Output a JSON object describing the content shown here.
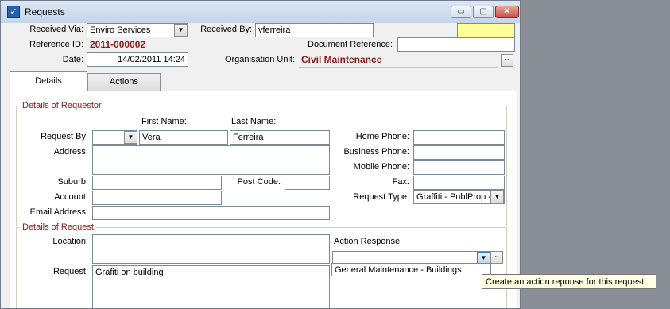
{
  "window": {
    "title": "Requests",
    "minimize": "▭",
    "maximize": "▢",
    "close": "✕"
  },
  "header": {
    "received_via_label": "Received Via:",
    "received_via_value": "Enviro Services",
    "received_by_label": "Received By:",
    "received_by_value": "vferreira",
    "reference_id_label": "Reference ID:",
    "reference_id_value": "2011-000002",
    "document_reference_label": "Document Reference:",
    "document_reference_value": "",
    "date_label": "Date:",
    "date_value": "14/02/2011 14:24",
    "org_unit_label": "Organisation Unit:",
    "org_unit_value": "Civil Maintenance"
  },
  "tabs": [
    {
      "label": "Details"
    },
    {
      "label": "Actions"
    }
  ],
  "requestor": {
    "group_title": "Details of Requestor",
    "first_name_label": "First Name:",
    "last_name_label": "Last Name:",
    "request_by_label": "Request By:",
    "request_by_value": "",
    "first_name_value": "Vera",
    "last_name_value": "Ferreira",
    "address_label": "Address:",
    "suburb_label": "Suburb:",
    "post_code_label": "Post Code:",
    "account_label": "Account:",
    "email_label": "Email Address:",
    "home_phone_label": "Home Phone:",
    "business_phone_label": "Business Phone:",
    "mobile_phone_label": "Mobile Phone:",
    "fax_label": "Fax:",
    "request_type_label": "Request Type:",
    "request_type_value": "Graffiti - PublProp - N"
  },
  "request": {
    "group_title": "Details of Request",
    "location_label": "Location:",
    "request_label": "Request:",
    "request_value": "Grafiti on building",
    "action_response_label": "Action Response",
    "action_response_value": "",
    "dropdown_option": "General Maintenance - Buildings"
  },
  "tooltip": {
    "text": "Create an action reponse for this request"
  },
  "colors": {
    "accent_red": "#8b1a1a",
    "highlight_yellow": "#ffff99",
    "tooltip_bg": "#ffffe1"
  }
}
